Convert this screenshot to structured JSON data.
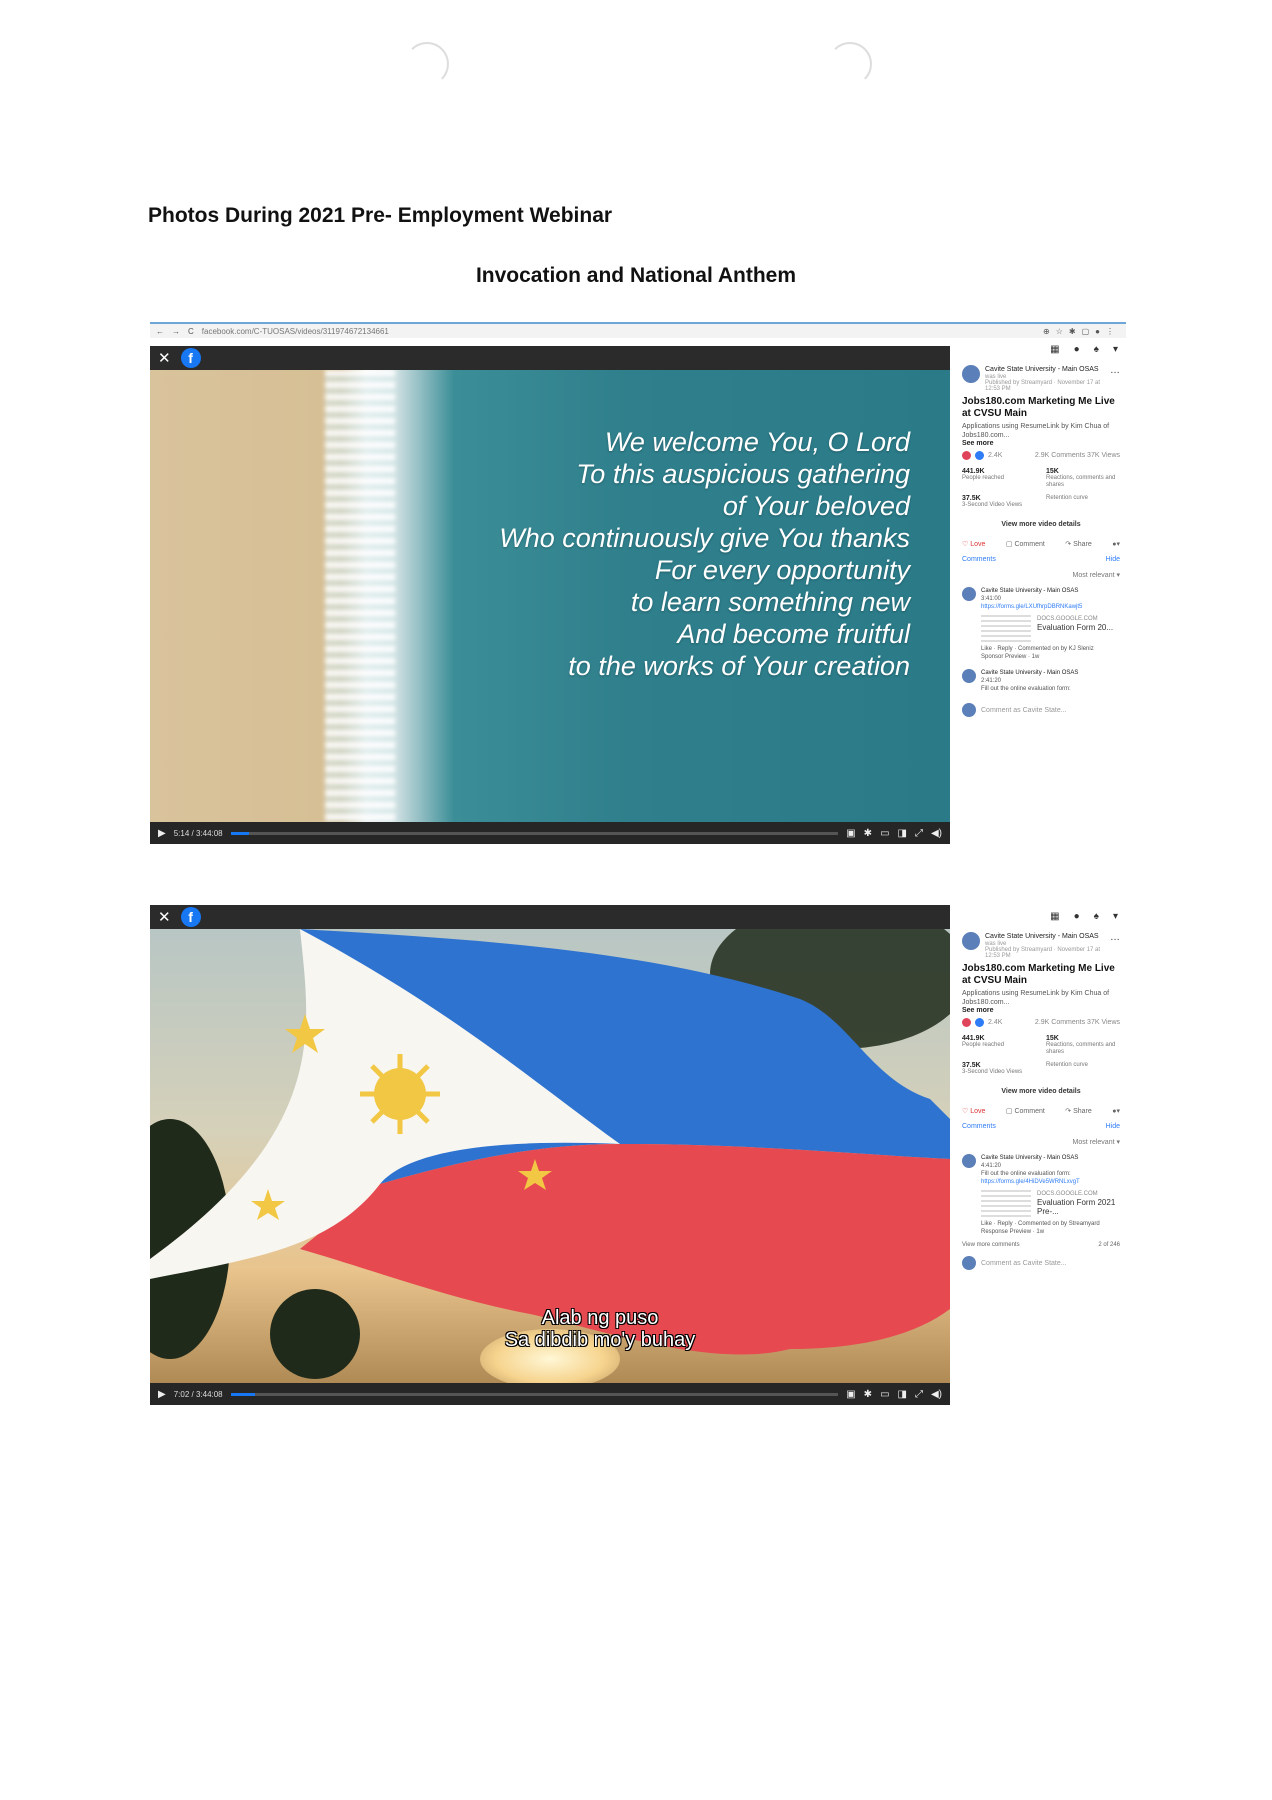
{
  "page": {
    "heading": "Photos During 2021 Pre- Employment Webinar",
    "subheading": "Invocation and National Anthem"
  },
  "screenshot1": {
    "url": "facebook.com/C-TUOSAS/videos/311974672134661",
    "lyrics": [
      "We welcome You, O Lord",
      "To this auspicious gathering",
      "of Your beloved",
      "Who continuously give You thanks",
      "For every opportunity",
      "to learn something new",
      "And become fruitful",
      "to the works of Your creation"
    ],
    "time": "5:14 / 3:44:08",
    "progress_fraction": 0.03,
    "post": {
      "page_name": "Cavite State University - Main OSAS",
      "status": "was live",
      "meta": "Published by Streamyard · November 17 at 12:53 PM",
      "title": "Jobs180.com Marketing Me Live at CVSU Main",
      "description": "Applications using ResumeLink by Kim Chua of Jobs180.com...",
      "see_more": "See more",
      "reactions_count": "2.4K",
      "comments_views": "2.9K Comments  37K Views",
      "stats": [
        {
          "value": "441.9K",
          "label": "People reached"
        },
        {
          "value": "15K",
          "label": "Reactions, comments and shares"
        },
        {
          "value": "37.5K",
          "label": "3-Second Video Views"
        },
        {
          "value": "",
          "label": "Retention curve"
        }
      ],
      "view_details": "View more video details",
      "actions": {
        "love": "Love",
        "comment": "Comment",
        "share": "Share"
      },
      "comments_label": "Comments",
      "hide_label": "Hide",
      "most_relevant": "Most relevant ▾",
      "comments": [
        {
          "name": "Cavite State University - Main OSAS",
          "time": "3:41:00",
          "text": "",
          "link": "https://forms.gle/LXUfhrpDBRNKawjt5",
          "preview_source": "DOCS.GOOGLE.COM",
          "preview_title": "Evaluation Form 20...",
          "footer": "Like · Reply · Commented on by KJ Sleniz",
          "footer2": "Sponsor Preview · 1w"
        },
        {
          "name": "Cavite State University - Main OSAS",
          "time": "2:41:20",
          "text": "Fill out the online evaluation form:",
          "link": "",
          "preview_source": "",
          "preview_title": "",
          "footer": "",
          "footer2": ""
        }
      ],
      "composer": "Comment as Cavite State..."
    }
  },
  "screenshot2": {
    "subtitle": [
      "Alab ng puso",
      "Sa dibdib mo'y buhay"
    ],
    "time": "7:02 / 3:44:08",
    "progress_fraction": 0.04,
    "post": {
      "page_name": "Cavite State University - Main OSAS",
      "status": "was live",
      "meta": "Published by Streamyard · November 17 at 12:53 PM",
      "title": "Jobs180.com Marketing Me Live at CVSU Main",
      "description": "Applications using ResumeLink by Kim Chua of Jobs180.com...",
      "see_more": "See more",
      "reactions_count": "2.4K",
      "comments_views": "2.9K Comments  37K Views",
      "stats": [
        {
          "value": "441.9K",
          "label": "People reached"
        },
        {
          "value": "15K",
          "label": "Reactions, comments and shares"
        },
        {
          "value": "37.5K",
          "label": "3-Second Video Views"
        },
        {
          "value": "",
          "label": "Retention curve"
        }
      ],
      "view_details": "View more video details",
      "actions": {
        "love": "Love",
        "comment": "Comment",
        "share": "Share"
      },
      "comments_label": "Comments",
      "hide_label": "Hide",
      "most_relevant": "Most relevant ▾",
      "comments": [
        {
          "name": "Cavite State University - Main OSAS",
          "time": "4:41:20",
          "text": "Fill out the online evaluation form:",
          "link": "https://forms.gle/4HiDVe5WRNLxvgT",
          "preview_source": "DOCS.GOOGLE.COM",
          "preview_title": "Evaluation Form 2021 Pre-...",
          "footer": "Like · Reply · Commented on by Streamyard",
          "footer2": "Response Preview · 1w"
        }
      ],
      "view_more_comments": "View more comments",
      "comment_count": "2 of 246",
      "composer": "Comment as Cavite State..."
    }
  }
}
